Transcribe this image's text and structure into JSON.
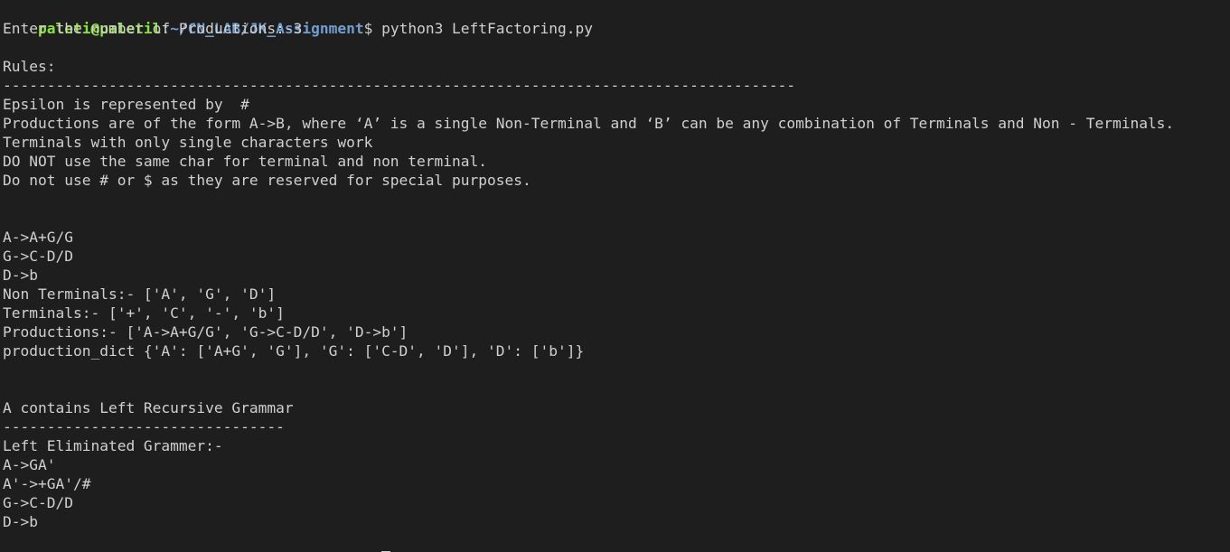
{
  "terminal": {
    "prompt_user": "paleti@paletil",
    "prompt_sep": ":",
    "prompt_path": "~/CN_LAB/JK_Assignment",
    "prompt_symbol": "$",
    "command": " python3 LeftFactoring.py",
    "output": [
      "Enter the number of Productions:-3",
      "",
      "Rules:",
      "------------------------------------------------------------------------------------------",
      "Epsilon is represented by  #",
      "Productions are of the form A->B, where ‘A’ is a single Non-Terminal and ‘B’ can be any combination of Terminals and Non - Terminals.",
      "Terminals with only single characters work",
      "DO NOT use the same char for terminal and non terminal.",
      "Do not use # or $ as they are reserved for special purposes.",
      "",
      "",
      "A->A+G/G",
      "G->C-D/D",
      "D->b",
      "Non Terminals:- ['A', 'G', 'D']",
      "Terminals:- ['+', 'C', '-', 'b']",
      "Productions:- ['A->A+G/G', 'G->C-D/D', 'D->b']",
      "production_dict {'A': ['A+G', 'G'], 'G': ['C-D', 'D'], 'D': ['b']}",
      "",
      "",
      "A contains Left Recursive Grammar",
      "--------------------------------",
      "Left Eliminated Grammer:-",
      "A->GA'",
      "A'->+GA'/#",
      "G->C-D/D",
      "D->b"
    ]
  },
  "colors": {
    "background": "#1e1e1e",
    "text": "#d0d0d0",
    "prompt_user": "#8ae234",
    "prompt_path": "#729fcf"
  }
}
